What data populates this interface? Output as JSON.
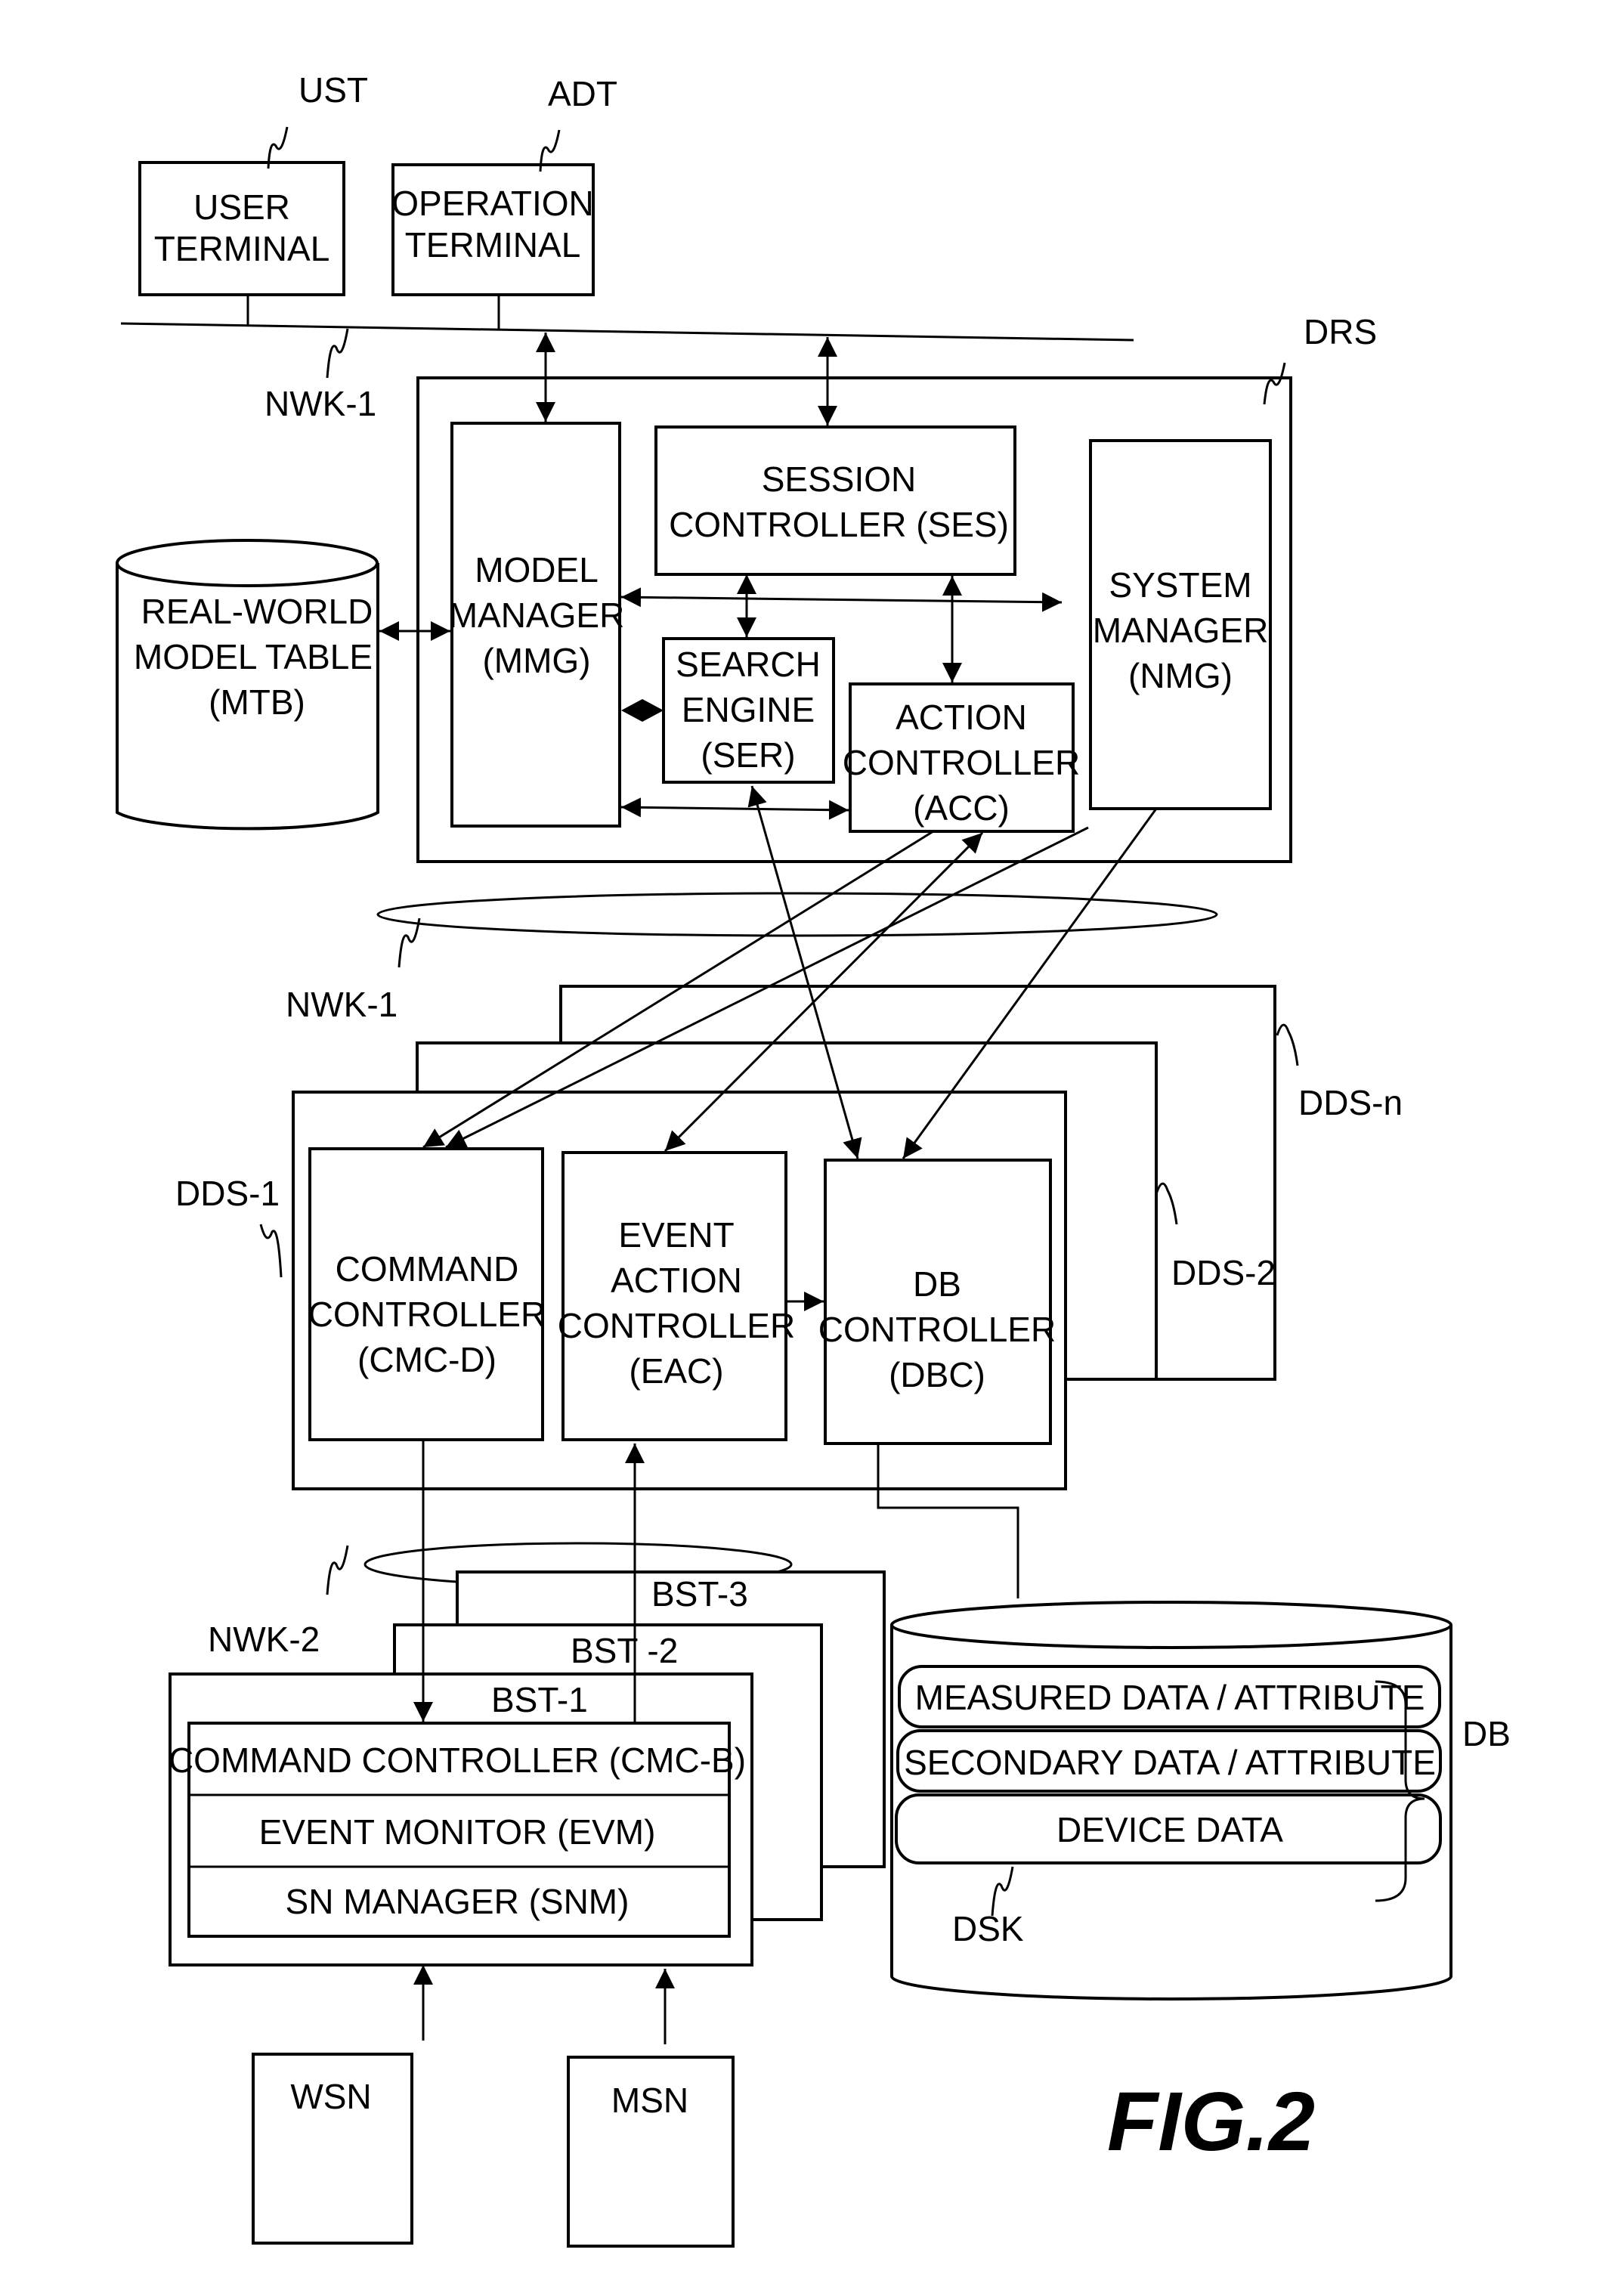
{
  "figure_label": "FIG.2",
  "refs": {
    "ust": "UST",
    "adt": "ADT",
    "nwk1_top": "NWK-1",
    "drs": "DRS",
    "nwk1_mid": "NWK-1",
    "dds_n": "DDS-n",
    "dds_1": "DDS-1",
    "dds_2": "DDS-2",
    "nwk2": "NWK-2",
    "bst3": "BST-3",
    "bst2": "BST -2",
    "bst1": "BST-1",
    "db": "DB",
    "dsk": "DSK"
  },
  "terminals": {
    "user": [
      "USER",
      "TERMINAL"
    ],
    "operation": [
      "OPERATION",
      "TERMINAL"
    ]
  },
  "mtb": [
    "REAL-WORLD",
    "MODEL TABLE",
    "(MTB)"
  ],
  "drs": {
    "mmg": [
      "MODEL",
      "MANAGER",
      "(MMG)"
    ],
    "ses": [
      "SESSION",
      "CONTROLLER (SES)"
    ],
    "nmg": [
      "SYSTEM",
      "MANAGER",
      "(NMG)"
    ],
    "ser": [
      "SEARCH",
      "ENGINE",
      "(SER)"
    ],
    "acc": [
      "ACTION",
      "CONTROLLER",
      "(ACC)"
    ]
  },
  "dds": {
    "cmc": [
      "COMMAND",
      "CONTROLLER",
      "(CMC-D)"
    ],
    "eac": [
      "EVENT",
      "ACTION",
      "CONTROLLER",
      "(EAC)"
    ],
    "dbc": [
      "DB",
      "CONTROLLER",
      "(DBC)"
    ]
  },
  "bst": {
    "cmc_b": "COMMAND CONTROLLER (CMC-B)",
    "evm": "EVENT MONITOR (EVM)",
    "snm": "SN MANAGER (SNM)"
  },
  "disk": {
    "measured": "MEASURED DATA / ATTRIBUTE",
    "secondary": "SECONDARY DATA / ATTRIBUTE",
    "device": "DEVICE DATA"
  },
  "sensors": {
    "wsn": "WSN",
    "msn": "MSN"
  }
}
